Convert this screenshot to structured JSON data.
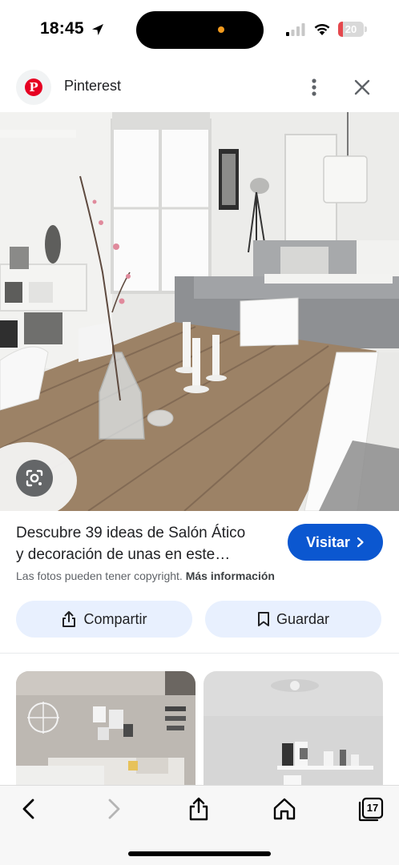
{
  "status_bar": {
    "time": "18:45",
    "battery_level": "20",
    "battery_fraction": 0.2,
    "battery_color": "#e5484d",
    "icons": [
      "location-arrow-icon",
      "cellular-signal-icon",
      "wifi-icon",
      "battery-icon"
    ]
  },
  "source": {
    "name": "Pinterest",
    "logo_letter": "P",
    "brand_color": "#e60023"
  },
  "result": {
    "title_line1": "Descubre 39 ideas de Salón Ático",
    "title_line2": "y decoración de unas en este…",
    "visit_label": "Visitar",
    "copyright_text": "Las fotos pueden tener copyright.",
    "more_info_label": "Más información",
    "accent_color": "#0b57d0"
  },
  "actions": {
    "share_label": "Compartir",
    "save_label": "Guardar"
  },
  "toolbar": {
    "tabs_count": "17",
    "icons": [
      "back-icon",
      "forward-icon",
      "share-icon",
      "home-icon",
      "tabs-icon"
    ]
  }
}
